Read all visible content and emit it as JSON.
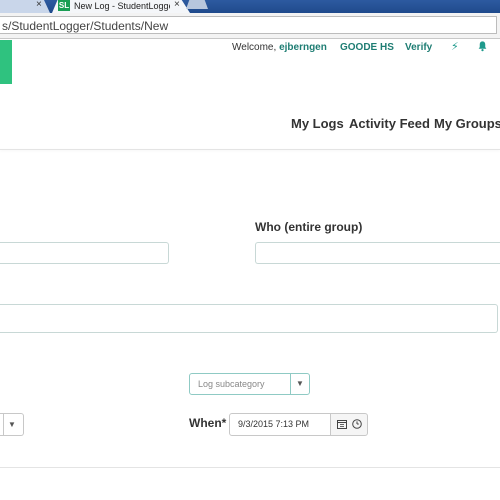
{
  "browser": {
    "previous_tab_close": "×",
    "active_tab": {
      "favicon_text": "SL",
      "title": "New Log - StudentLogger",
      "close": "×"
    },
    "address": "s/StudentLogger/Students/New"
  },
  "header": {
    "welcome_label": "Welcome,",
    "username": "ejberngen",
    "school": "GOODE HS",
    "verify": "Verify",
    "icons": [
      "bolt-icon",
      "bell-icon"
    ],
    "accent_color": "#1e7d73",
    "brand_color": "#2fc27f"
  },
  "nav": {
    "my_logs": "My Logs",
    "activity_feed": "Activity Feed",
    "my_groups": "My Groups"
  },
  "form": {
    "who_label": "Who (entire group)",
    "subcategory_placeholder": "Log subcategory",
    "when_label": "When*",
    "when_value": "9/3/2015 7:13 PM",
    "dropdown_arrow": "▼"
  }
}
